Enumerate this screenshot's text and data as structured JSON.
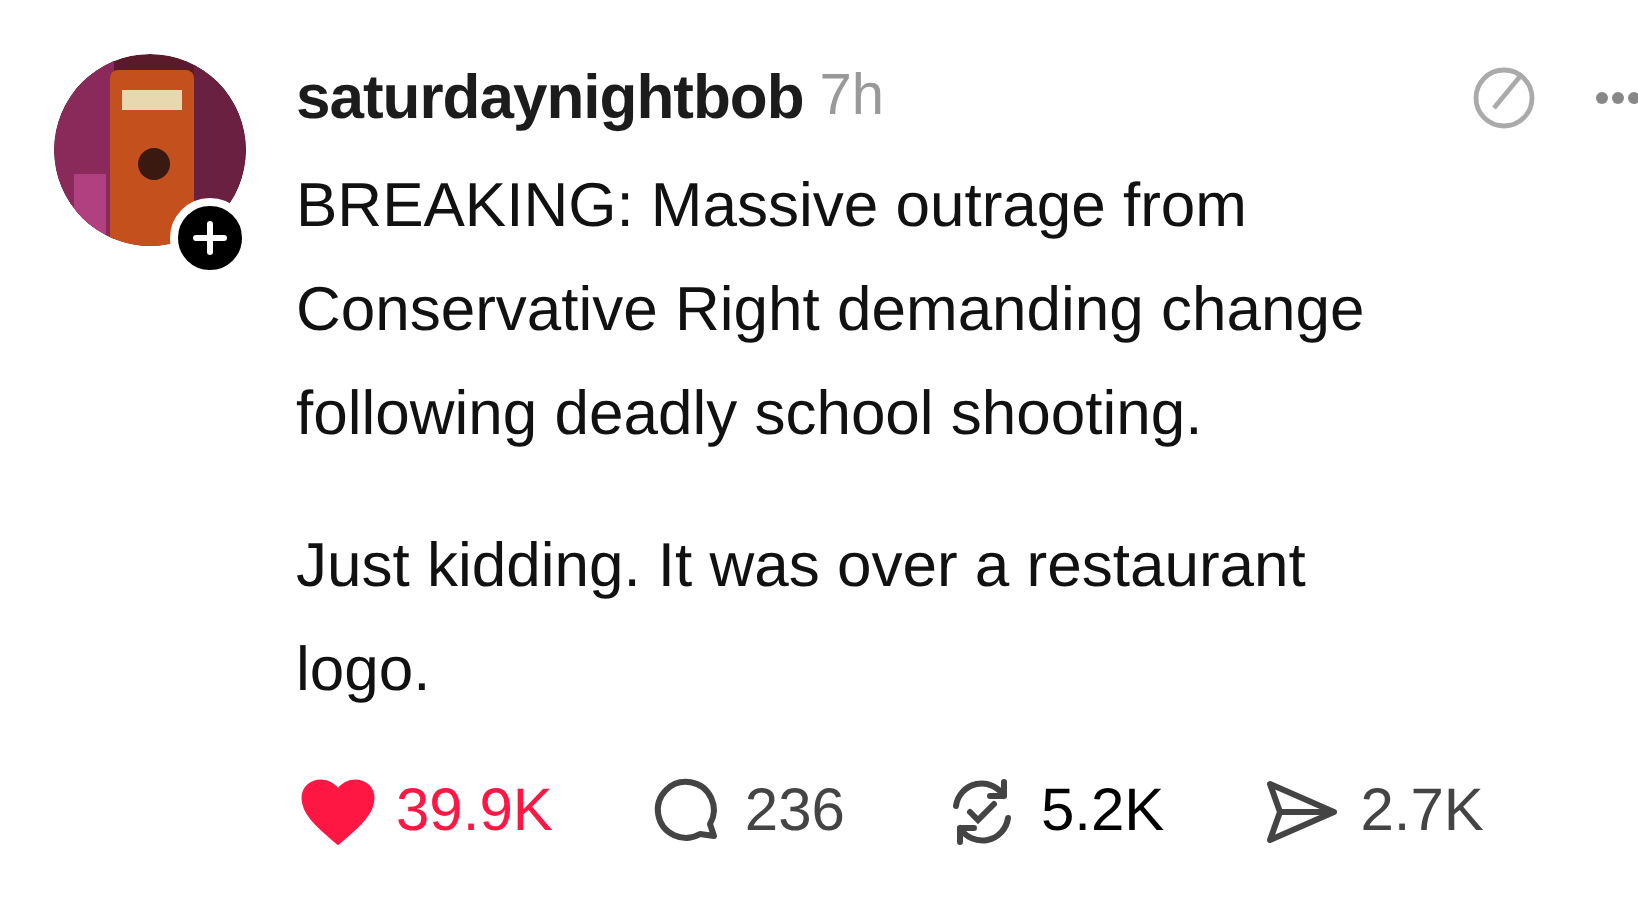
{
  "post": {
    "username": "saturdaynightbob",
    "time": "7h",
    "paragraphs": [
      {
        "lines": [
          "BREAKING: Massive outrage from",
          "Conservative Right demanding change",
          "following deadly school shooting."
        ]
      },
      {
        "lines": [
          "Just kidding. It was over a restaurant",
          "logo."
        ]
      }
    ],
    "actions": [
      {
        "kind": "like",
        "count": "39.9K",
        "active": true
      },
      {
        "kind": "reply",
        "count": "236",
        "active": false
      },
      {
        "kind": "repost",
        "count": "5.2K",
        "active": true
      },
      {
        "kind": "share",
        "count": "2.7K",
        "active": false
      }
    ]
  }
}
